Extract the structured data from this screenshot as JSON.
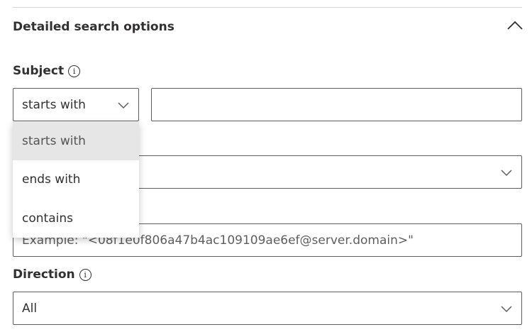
{
  "section": {
    "title": "Detailed search options",
    "collapse_icon": "chevron-up-icon"
  },
  "subject": {
    "label": "Subject",
    "operator_value": "starts with",
    "text_value": "",
    "options": [
      "starts with",
      "ends with",
      "contains"
    ],
    "highlighted": "starts with"
  },
  "hidden_select": {
    "value": ""
  },
  "message_id": {
    "placeholder": "Example: \"<08f1e0f806a47b4ac109109ae6ef@server.domain>\""
  },
  "direction": {
    "label": "Direction",
    "value": "All"
  }
}
